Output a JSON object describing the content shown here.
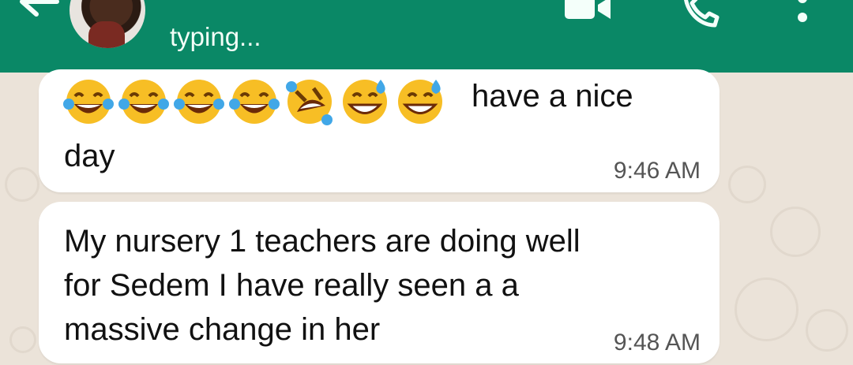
{
  "header": {
    "status": "typing..."
  },
  "messages": [
    {
      "emoji": [
        "laughing-tears",
        "laughing-tears",
        "laughing-tears",
        "laughing-tears",
        "rolling-laughing",
        "sweat-smile",
        "sweat-smile"
      ],
      "text_inline": "have a nice",
      "text_wrap": "day",
      "time": "9:46 AM"
    },
    {
      "text": "My nursery 1 teachers are doing well\nfor Sedem I have really seen a a\nmassive change in her",
      "time": "9:48 AM"
    }
  ],
  "colors": {
    "header": "#0a8866",
    "wallpaper": "#ebe3d9",
    "bubble": "#ffffff"
  }
}
